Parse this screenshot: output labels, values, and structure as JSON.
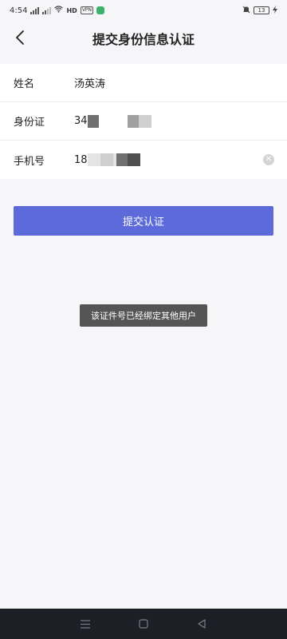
{
  "status_bar": {
    "time": "4:54",
    "network_type": "HD",
    "vpn_label": "VPN",
    "battery": "13"
  },
  "header": {
    "title": "提交身份信息认证"
  },
  "form": {
    "name": {
      "label": "姓名",
      "value": "汤英涛"
    },
    "id_card": {
      "label": "身份证",
      "value_visible": "34"
    },
    "phone": {
      "label": "手机号",
      "value_visible": "18"
    }
  },
  "submit": {
    "label": "提交认证",
    "color": "#5c6bd9"
  },
  "toast": {
    "message": "该证件号已经绑定其他用户"
  },
  "icons": {
    "back": "chevron-left-icon",
    "clear": "clear-icon",
    "nav_menu": "menu-icon",
    "nav_home": "home-icon",
    "nav_back": "back-triangle-icon"
  }
}
